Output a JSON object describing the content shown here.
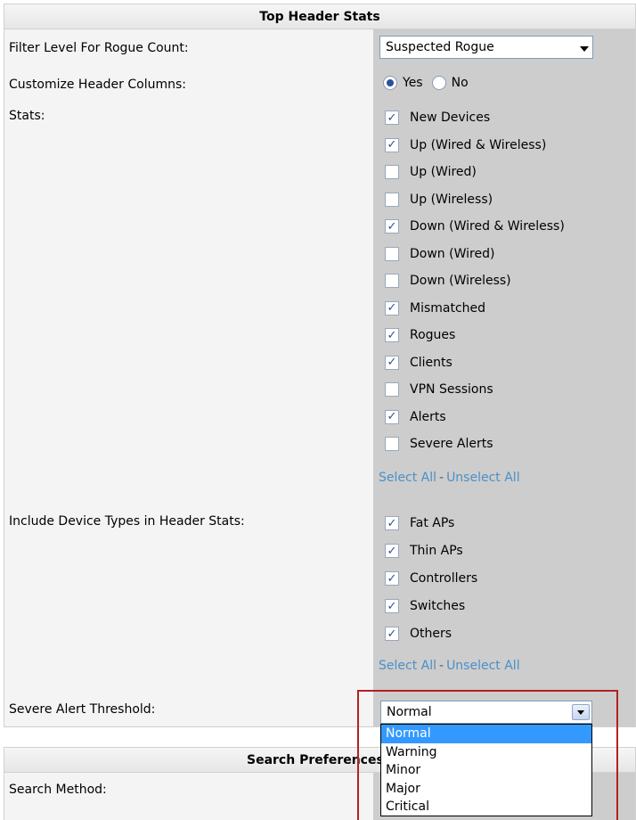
{
  "top_panel": {
    "title": "Top Header Stats",
    "filter_label": "Filter Level For Rogue Count:",
    "filter_value": "Suspected Rogue",
    "customize_label": "Customize Header Columns:",
    "customize_yes": "Yes",
    "customize_no": "No",
    "customize_selected": "Yes",
    "stats_label": "Stats:",
    "stats": [
      {
        "label": "New Devices",
        "checked": true
      },
      {
        "label": "Up (Wired & Wireless)",
        "checked": true
      },
      {
        "label": "Up (Wired)",
        "checked": false
      },
      {
        "label": "Up (Wireless)",
        "checked": false
      },
      {
        "label": "Down (Wired & Wireless)",
        "checked": true
      },
      {
        "label": "Down (Wired)",
        "checked": false
      },
      {
        "label": "Down (Wireless)",
        "checked": false
      },
      {
        "label": "Mismatched",
        "checked": true
      },
      {
        "label": "Rogues",
        "checked": true
      },
      {
        "label": "Clients",
        "checked": true
      },
      {
        "label": "VPN Sessions",
        "checked": false
      },
      {
        "label": "Alerts",
        "checked": true
      },
      {
        "label": "Severe Alerts",
        "checked": false
      }
    ],
    "select_all": "Select All",
    "separator": "-",
    "unselect_all": "Unselect All",
    "device_types_label": "Include Device Types in Header Stats:",
    "device_types": [
      {
        "label": "Fat APs",
        "checked": true
      },
      {
        "label": "Thin APs",
        "checked": true
      },
      {
        "label": "Controllers",
        "checked": true
      },
      {
        "label": "Switches",
        "checked": true
      },
      {
        "label": "Others",
        "checked": true
      }
    ],
    "threshold_label": "Severe Alert Threshold:",
    "threshold_value": "Normal",
    "threshold_options": [
      "Normal",
      "Warning",
      "Minor",
      "Major",
      "Critical"
    ],
    "threshold_highlighted": "Normal"
  },
  "search_panel": {
    "title": "Search Preferences",
    "method_label": "Search Method:"
  },
  "colors": {
    "link": "#4a90c8",
    "highlight_box": "#b22222",
    "dropdown_selected": "#3399ff"
  }
}
